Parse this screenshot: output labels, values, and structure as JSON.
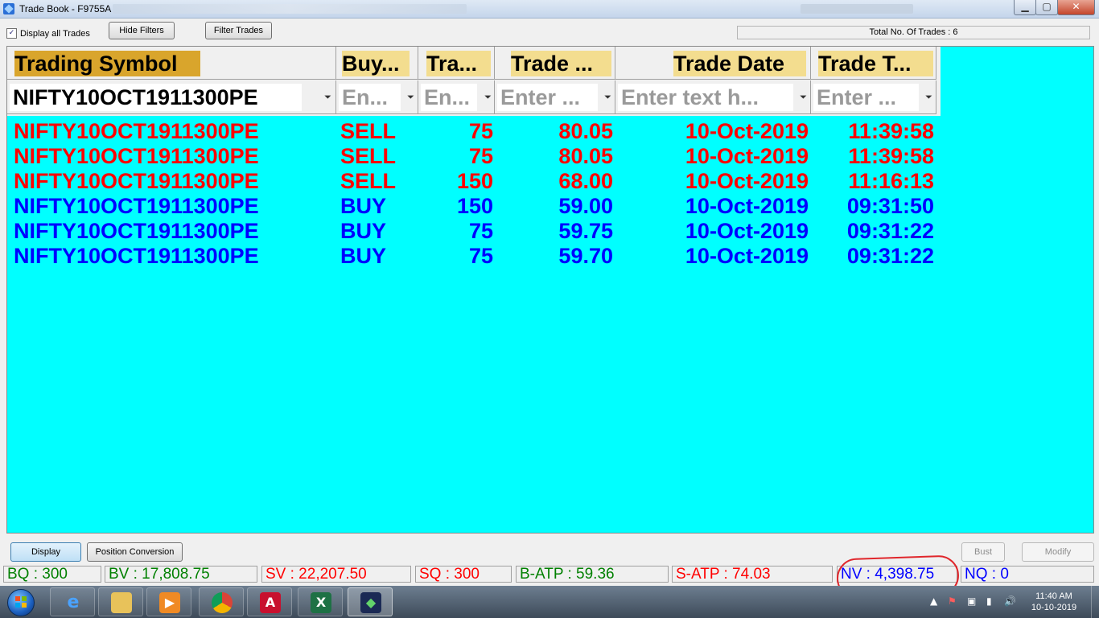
{
  "window": {
    "title": "Trade Book - F9755A",
    "controls": {
      "minimize": "▁",
      "maximize": "▢",
      "close": "✕"
    }
  },
  "toolbar": {
    "display_all_trades_label": "Display all Trades",
    "display_all_trades_checked": true,
    "hide_filters_label": "Hide Filters",
    "filter_trades_label": "Filter Trades",
    "total_trades_text": "Total No. Of Trades : 6"
  },
  "grid": {
    "columns": [
      {
        "label": "Trading Symbol",
        "filter_text": "NIFTY10OCT1911300PE"
      },
      {
        "label": "Buy...",
        "filter_text": "En..."
      },
      {
        "label": "Tra...",
        "filter_text": "En..."
      },
      {
        "label": "Trade ...",
        "filter_text": "Enter ..."
      },
      {
        "label": "Trade Date",
        "filter_text": "Enter text h..."
      },
      {
        "label": "Trade T...",
        "filter_text": "Enter ..."
      }
    ],
    "rows": [
      {
        "side": "sell",
        "cells": [
          "NIFTY10OCT1911300PE",
          "SELL",
          "75",
          "80.05",
          "10-Oct-2019",
          "11:39:58"
        ]
      },
      {
        "side": "sell",
        "cells": [
          "NIFTY10OCT1911300PE",
          "SELL",
          "75",
          "80.05",
          "10-Oct-2019",
          "11:39:58"
        ]
      },
      {
        "side": "sell",
        "cells": [
          "NIFTY10OCT1911300PE",
          "SELL",
          "150",
          "68.00",
          "10-Oct-2019",
          "11:16:13"
        ]
      },
      {
        "side": "buy",
        "cells": [
          "NIFTY10OCT1911300PE",
          "BUY",
          "150",
          "59.00",
          "10-Oct-2019",
          "09:31:50"
        ]
      },
      {
        "side": "buy",
        "cells": [
          "NIFTY10OCT1911300PE",
          "BUY",
          "75",
          "59.75",
          "10-Oct-2019",
          "09:31:22"
        ]
      },
      {
        "side": "buy",
        "cells": [
          "NIFTY10OCT1911300PE",
          "BUY",
          "75",
          "59.70",
          "10-Oct-2019",
          "09:31:22"
        ]
      }
    ],
    "colors": {
      "background": "#00ffff",
      "sell": "#ff0000",
      "buy": "#0000ff",
      "header_label": "#f3dd8f",
      "header_active": "#d9a52c"
    }
  },
  "actions": {
    "display_label": "Display",
    "position_conversion_label": "Position Conversion",
    "bust_label": "Bust",
    "modify_label": "Modify"
  },
  "summary": {
    "bq": "BQ : 300",
    "bv": "BV : 17,808.75",
    "sv": "SV : 22,207.50",
    "sq": "SQ : 300",
    "batp": "B-ATP : 59.36",
    "satp": "S-ATP : 74.03",
    "nv": "NV : 4,398.75",
    "nq": "NQ : 0"
  },
  "taskbar": {
    "apps": [
      "internet-explorer-icon",
      "file-explorer-icon",
      "media-player-icon",
      "chrome-icon",
      "acrobat-icon",
      "excel-icon",
      "trading-app-icon"
    ],
    "clock_time": "11:40 AM",
    "clock_date": "10-10-2019"
  }
}
